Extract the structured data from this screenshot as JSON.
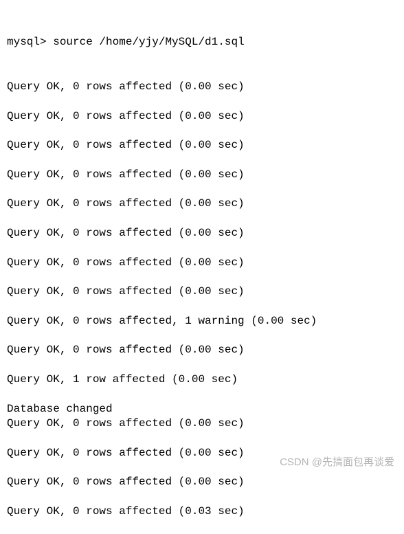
{
  "prompt": "mysql> ",
  "command": "source /home/yjy/MySQL/d1.sql",
  "results": [
    {
      "text": "Query OK, 0 rows affected (0.00 sec)",
      "gap": true,
      "attached": true
    },
    {
      "text": "Query OK, 0 rows affected (0.00 sec)",
      "gap": true
    },
    {
      "text": "Query OK, 0 rows affected (0.00 sec)",
      "gap": true
    },
    {
      "text": "Query OK, 0 rows affected (0.00 sec)",
      "gap": true
    },
    {
      "text": "Query OK, 0 rows affected (0.00 sec)",
      "gap": true
    },
    {
      "text": "Query OK, 0 rows affected (0.00 sec)",
      "gap": true
    },
    {
      "text": "Query OK, 0 rows affected (0.00 sec)",
      "gap": true
    },
    {
      "text": "Query OK, 0 rows affected (0.00 sec)",
      "gap": true
    },
    {
      "text": "Query OK, 0 rows affected, 1 warning (0.00 sec)",
      "gap": true
    },
    {
      "text": "Query OK, 0 rows affected (0.00 sec)",
      "gap": true
    },
    {
      "text": "Query OK, 1 row affected (0.00 sec)",
      "gap": true
    },
    {
      "text": "Database changed",
      "gap": false
    },
    {
      "text": "Query OK, 0 rows affected (0.00 sec)",
      "gap": true
    },
    {
      "text": "Query OK, 0 rows affected (0.00 sec)",
      "gap": true
    },
    {
      "text": "Query OK, 0 rows affected (0.00 sec)",
      "gap": true
    },
    {
      "text": "Query OK, 0 rows affected (0.03 sec)",
      "gap": false
    }
  ],
  "watermark": "CSDN @先搞面包再谈爱"
}
